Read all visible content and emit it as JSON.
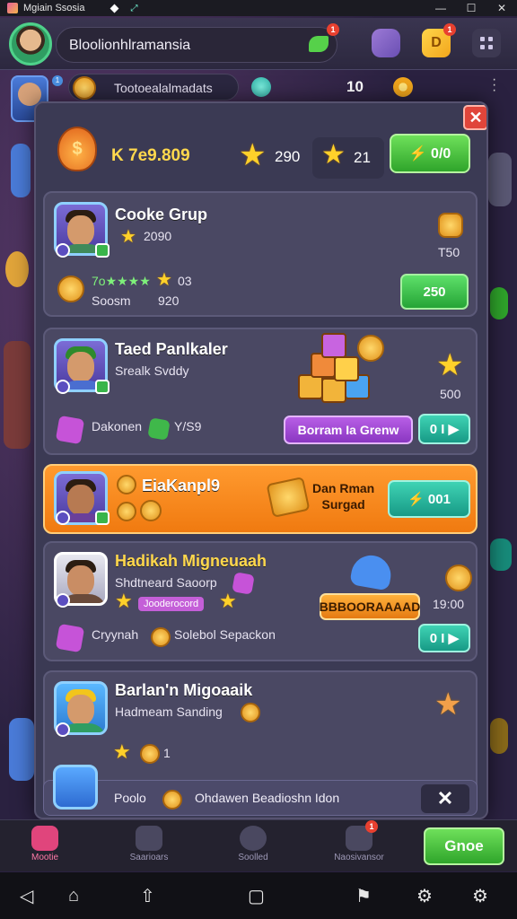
{
  "window": {
    "title": "Mgiain Ssosia",
    "controls": [
      "—",
      "☐",
      "✕"
    ]
  },
  "header": {
    "username": "Bloolionhlramansia",
    "badges": {
      "green": "1",
      "yellow": "1"
    }
  },
  "subheader": {
    "side_badge": "1",
    "coin_text": "Tootoealalmadats",
    "count": "10"
  },
  "modal": {
    "top_amount": "K 7e9.809",
    "star_value_1": "290",
    "star_value_2": "21",
    "top_button": "⚡ 0/0",
    "cards": [
      {
        "title": "Cooke Grup",
        "score": "2090",
        "stars_label": "7o★★★★",
        "stars_num": "03",
        "line2_a": "Soosm",
        "line2_b": "920",
        "right_value": "T50",
        "button": "250"
      },
      {
        "title": "Taed Panlkaler",
        "subtitle": "Srealk Svddy",
        "line_a": "Dakonen",
        "line_b": "Y/S9",
        "right_value": "500",
        "purple_button": "Borram Ia Grenw",
        "teal_button": "0 I ▶"
      },
      {
        "title": "EiaKanpl9",
        "promo_text": "Dan Rman\nSurgad",
        "button": "⚡ 001"
      },
      {
        "title": "Hadikah Migneuaah",
        "subtitle": "Shdtneard Saoorp",
        "tag": "Jooderocord",
        "orange_button": "BBBOORAAAAD",
        "right_value": "19:00",
        "line_a": "Cryynah",
        "line_b": "Solebol Sepackon",
        "teal_button": "0 I ▶"
      },
      {
        "title": "Barlan'n Migoaaik",
        "subtitle": "Hadmeam Sanding",
        "coin_count": "1"
      }
    ],
    "notice": {
      "label": "Poolo",
      "text": "Ohdawen Beadioshn Idon",
      "close": "✕"
    }
  },
  "bottom_nav": {
    "items": [
      "Mootie",
      "Saarioars",
      "Soolled",
      "Naosivansor"
    ],
    "go_button": "Gnoe",
    "badge": "1"
  },
  "system_nav": [
    "◁",
    "⌂",
    "⇧",
    "▢",
    "⚑",
    "⚙",
    "⚙"
  ]
}
